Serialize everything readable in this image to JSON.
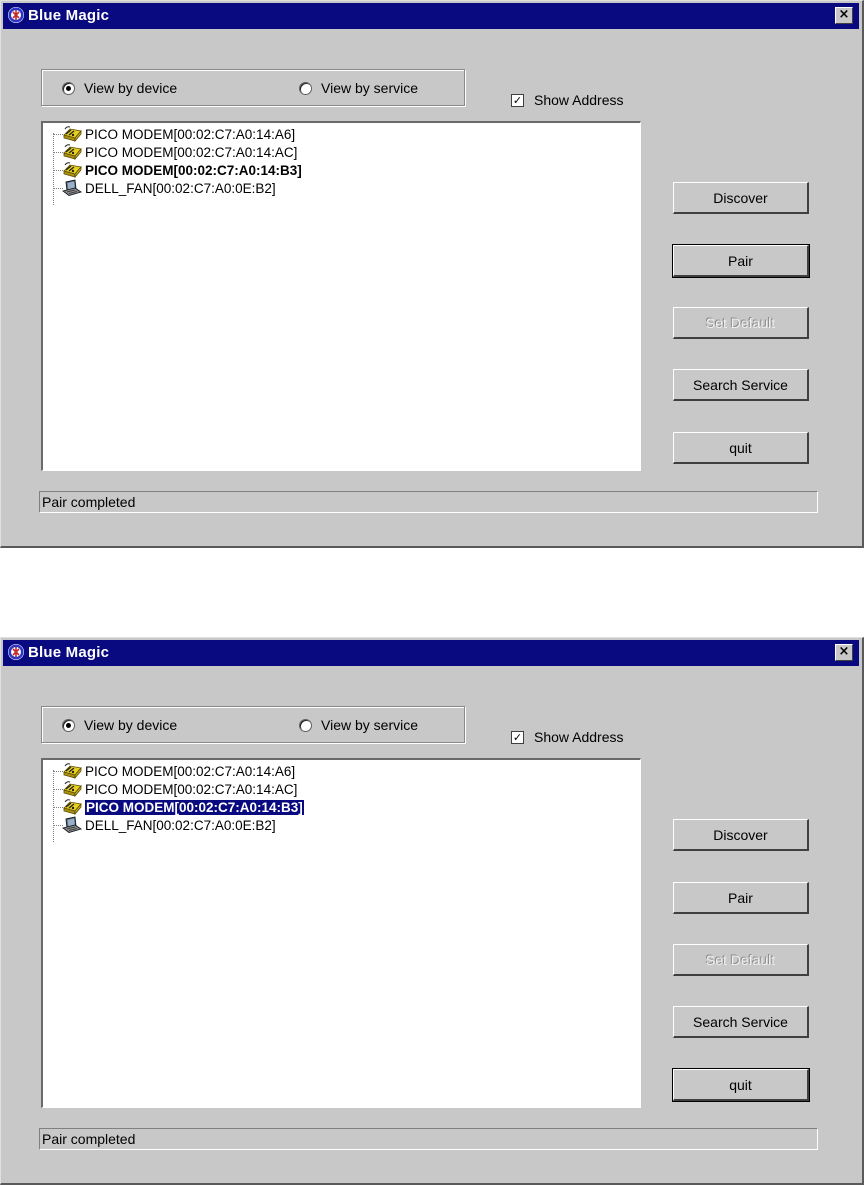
{
  "windows": [
    {
      "title": "Blue Magic",
      "close_glyph": "×",
      "view_by_device_label": "View by device",
      "view_by_device_selected": true,
      "view_by_service_label": "View by service",
      "view_by_service_selected": false,
      "show_address_label": "Show Address",
      "show_address_checked": true,
      "check_glyph": "✓",
      "devices": [
        {
          "label": "PICO MODEM[00:02:C7:A0:14:A6]",
          "icon": "modem-icon",
          "style": "normal"
        },
        {
          "label": "PICO MODEM[00:02:C7:A0:14:AC]",
          "icon": "modem-icon",
          "style": "normal"
        },
        {
          "label": "PICO MODEM[00:02:C7:A0:14:B3]",
          "icon": "modem-icon",
          "style": "bold"
        },
        {
          "label": "DELL_FAN[00:02:C7:A0:0E:B2]",
          "icon": "laptop-icon",
          "style": "normal"
        }
      ],
      "buttons": {
        "discover": "Discover",
        "pair": "Pair",
        "set_default": "Set Default",
        "search_service": "Search Service",
        "quit": "quit"
      },
      "default_button": "pair",
      "status": "Pair completed"
    },
    {
      "title": "Blue Magic",
      "close_glyph": "×",
      "view_by_device_label": "View by device",
      "view_by_device_selected": true,
      "view_by_service_label": "View by service",
      "view_by_service_selected": false,
      "show_address_label": "Show Address",
      "show_address_checked": true,
      "check_glyph": "✓",
      "devices": [
        {
          "label": "PICO MODEM[00:02:C7:A0:14:A6]",
          "icon": "modem-icon",
          "style": "normal"
        },
        {
          "label": "PICO MODEM[00:02:C7:A0:14:AC]",
          "icon": "modem-icon",
          "style": "normal"
        },
        {
          "label": "PICO MODEM[00:02:C7:A0:14:B3]",
          "icon": "modem-icon",
          "style": "selected"
        },
        {
          "label": "DELL_FAN[00:02:C7:A0:0E:B2]",
          "icon": "laptop-icon",
          "style": "normal"
        }
      ],
      "buttons": {
        "discover": "Discover",
        "pair": "Pair",
        "set_default": "Set Default",
        "search_service": "Search Service",
        "quit": "quit"
      },
      "default_button": "quit",
      "status": "Pair completed"
    }
  ],
  "colors": {
    "titlebar": "#0a0a80",
    "dialog_face": "#c8c8c8",
    "selection": "#0a0a80"
  }
}
